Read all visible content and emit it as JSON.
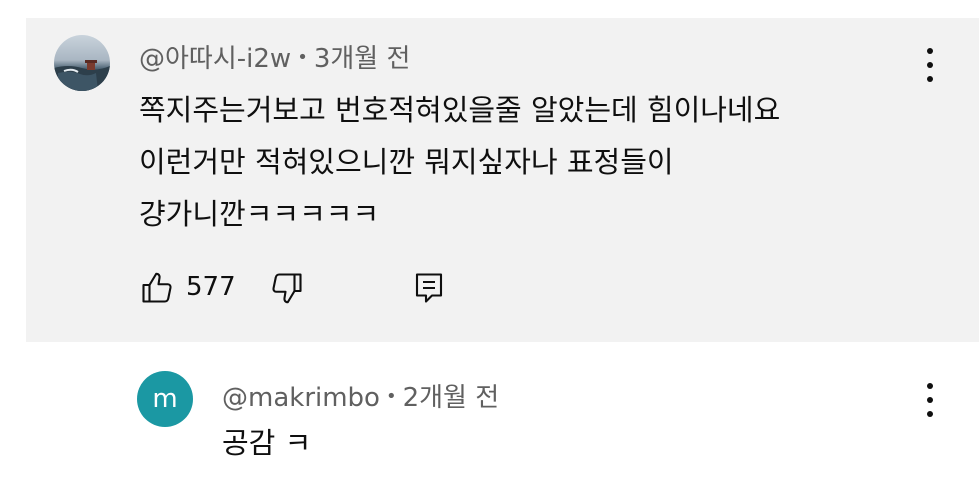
{
  "comment": {
    "author": "@아따시-i2w",
    "separator": "•",
    "time": "3개월 전",
    "lines": [
      "쪽지주는거보고 번호적혀있을줄 알았는데 힘이나네요",
      "이런거만 적혀있으니깐 뭐지싶자나 표정들이",
      "걍가니깐ㅋㅋㅋㅋㅋ"
    ],
    "like_count": "577",
    "icons": {
      "like": "thumbs-up-icon",
      "dislike": "thumbs-down-icon",
      "reply": "reply-icon",
      "menu": "more-vert-icon"
    }
  },
  "reply": {
    "avatar_letter": "m",
    "avatar_color": "#1b98a3",
    "author": "@makrimbo",
    "separator": "•",
    "time": "2개월 전",
    "text": "공감 ㅋ"
  },
  "colors": {
    "highlight_bg": "#f2f2f2",
    "meta_text": "#606060",
    "body_text": "#0f0f0f"
  }
}
